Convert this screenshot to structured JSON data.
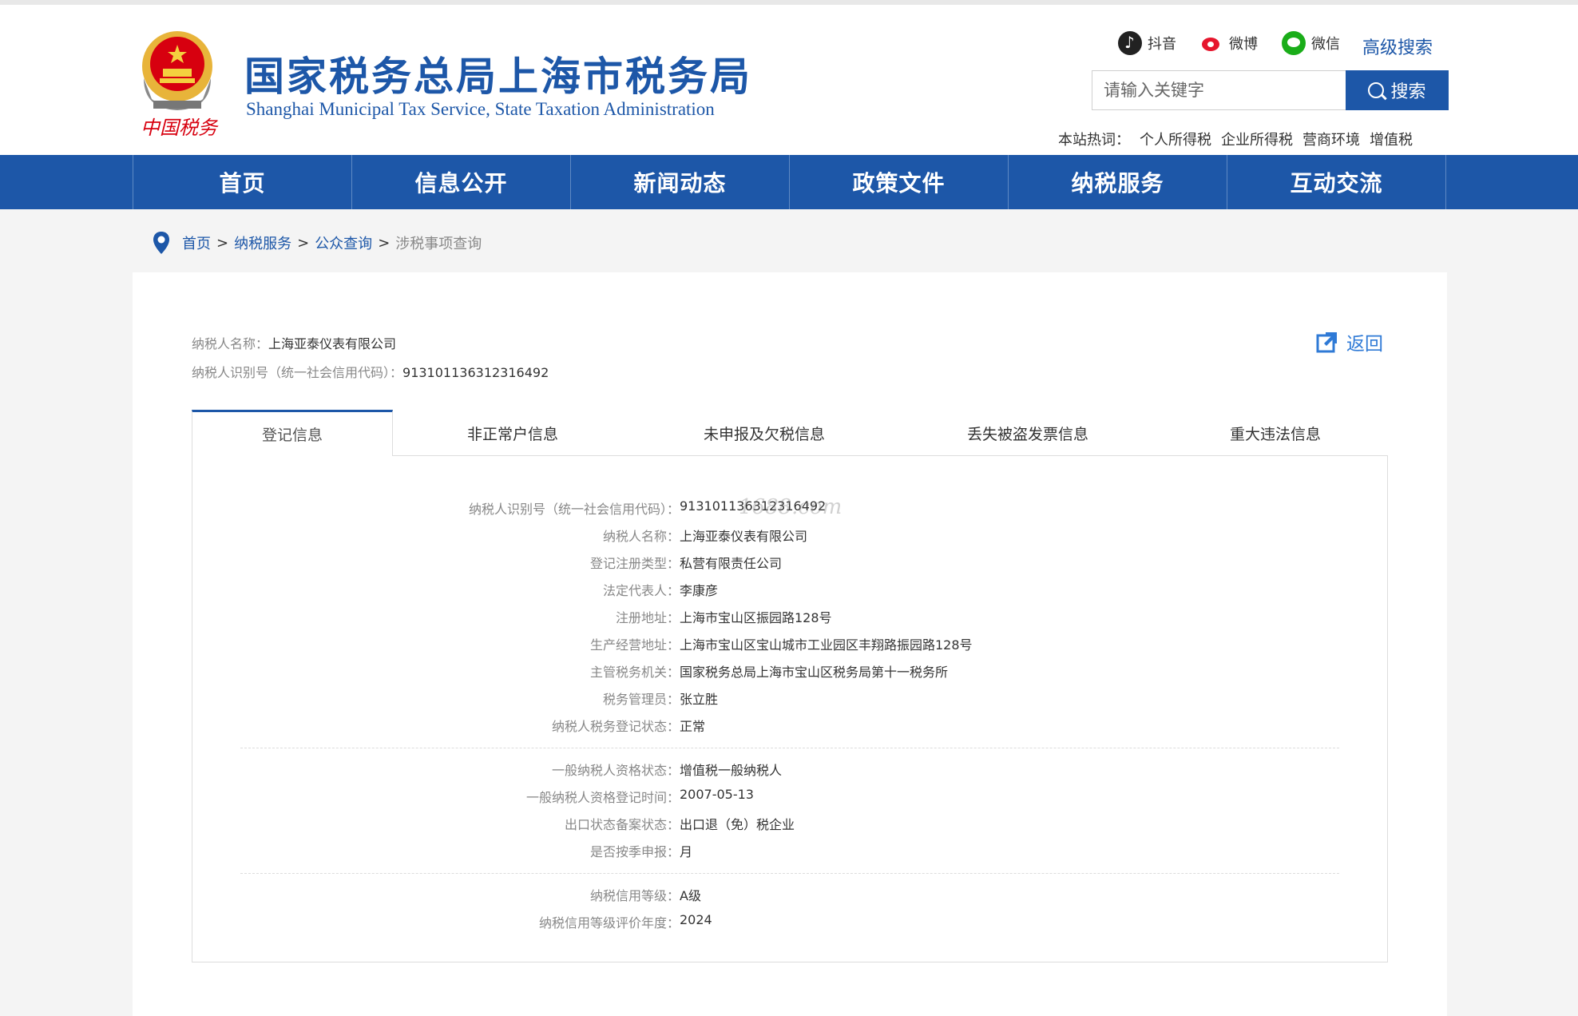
{
  "header": {
    "title": "国家税务总局上海市税务局",
    "subtitle": "Shanghai Municipal Tax Service, State Taxation Administration",
    "emblem_caption": "中国税务",
    "social": [
      {
        "label": "抖音",
        "icon": "douyin-icon"
      },
      {
        "label": "微博",
        "icon": "weibo-icon"
      },
      {
        "label": "微信",
        "icon": "wechat-icon"
      }
    ],
    "advanced_search": "高级搜索",
    "search": {
      "placeholder": "请输入关键字",
      "button": "搜索"
    },
    "hot_label": "本站热词：",
    "hot_words": [
      "个人所得税",
      "企业所得税",
      "营商环境",
      "增值税"
    ]
  },
  "nav": [
    "首页",
    "信息公开",
    "新闻动态",
    "政策文件",
    "纳税服务",
    "互动交流"
  ],
  "breadcrumb": {
    "links": [
      "首页",
      "纳税服务",
      "公众查询"
    ],
    "separator": ">",
    "current": "涉税事项查询"
  },
  "taxpayer": {
    "name_label": "纳税人名称：",
    "name": "上海亚泰仪表有限公司",
    "id_label": "纳税人识别号（统一社会信用代码）：",
    "id": "913101136312316492"
  },
  "back_label": "返回",
  "tabs": [
    "登记信息",
    "非正常户信息",
    "未申报及欠税信息",
    "丢失被盗发票信息",
    "重大违法信息"
  ],
  "active_tab": "登记信息",
  "watermark": "1688.com",
  "details": {
    "group1": [
      {
        "key": "纳税人识别号（统一社会信用代码）：",
        "value": "913101136312316492"
      },
      {
        "key": "纳税人名称：",
        "value": "上海亚泰仪表有限公司"
      },
      {
        "key": "登记注册类型：",
        "value": "私营有限责任公司"
      },
      {
        "key": "法定代表人：",
        "value": "李康彦"
      },
      {
        "key": "注册地址：",
        "value": "上海市宝山区振园路128号"
      },
      {
        "key": "生产经营地址：",
        "value": "上海市宝山区宝山城市工业园区丰翔路振园路128号"
      },
      {
        "key": "主管税务机关：",
        "value": "国家税务总局上海市宝山区税务局第十一税务所"
      },
      {
        "key": "税务管理员：",
        "value": "张立胜"
      },
      {
        "key": "纳税人税务登记状态：",
        "value": "正常"
      }
    ],
    "group2": [
      {
        "key": "一般纳税人资格状态：",
        "value": "增值税一般纳税人"
      },
      {
        "key": "一般纳税人资格登记时间：",
        "value": "2007-05-13"
      },
      {
        "key": "出口状态备案状态：",
        "value": "出口退（免）税企业"
      },
      {
        "key": "是否按季申报：",
        "value": "月"
      }
    ],
    "group3": [
      {
        "key": "纳税信用等级：",
        "value": "A级"
      },
      {
        "key": "纳税信用等级评价年度：",
        "value": "2024"
      }
    ]
  },
  "colors": {
    "brand": "#1d57a8",
    "link": "#2f7ad6",
    "emblem_red": "#d7000f",
    "emblem_gold": "#e8b43a"
  }
}
